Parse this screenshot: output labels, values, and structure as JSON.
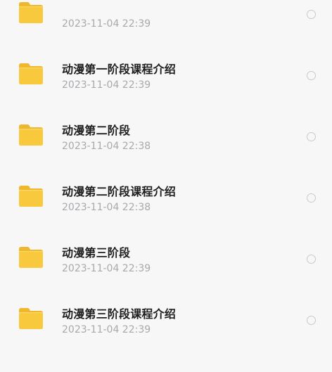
{
  "files": [
    {
      "name": "",
      "date": "2023-11-04 22:39",
      "icon": "folder-icon"
    },
    {
      "name": "动漫第一阶段课程介绍",
      "date": "2023-11-04 22:39",
      "icon": "folder-icon"
    },
    {
      "name": "动漫第二阶段",
      "date": "2023-11-04 22:38",
      "icon": "folder-icon"
    },
    {
      "name": "动漫第二阶段课程介绍",
      "date": "2023-11-04 22:38",
      "icon": "folder-icon"
    },
    {
      "name": "动漫第三阶段",
      "date": "2023-11-04 22:39",
      "icon": "folder-icon"
    },
    {
      "name": "动漫第三阶段课程介绍",
      "date": "2023-11-04 22:39",
      "icon": "folder-icon"
    }
  ],
  "colors": {
    "folder": "#f8c93c",
    "folder_tab": "#f0b62c",
    "background": "#f7f7f8",
    "title": "#1f1f1f",
    "date": "#a9a9ad",
    "radio_border": "#c9c9cd"
  }
}
